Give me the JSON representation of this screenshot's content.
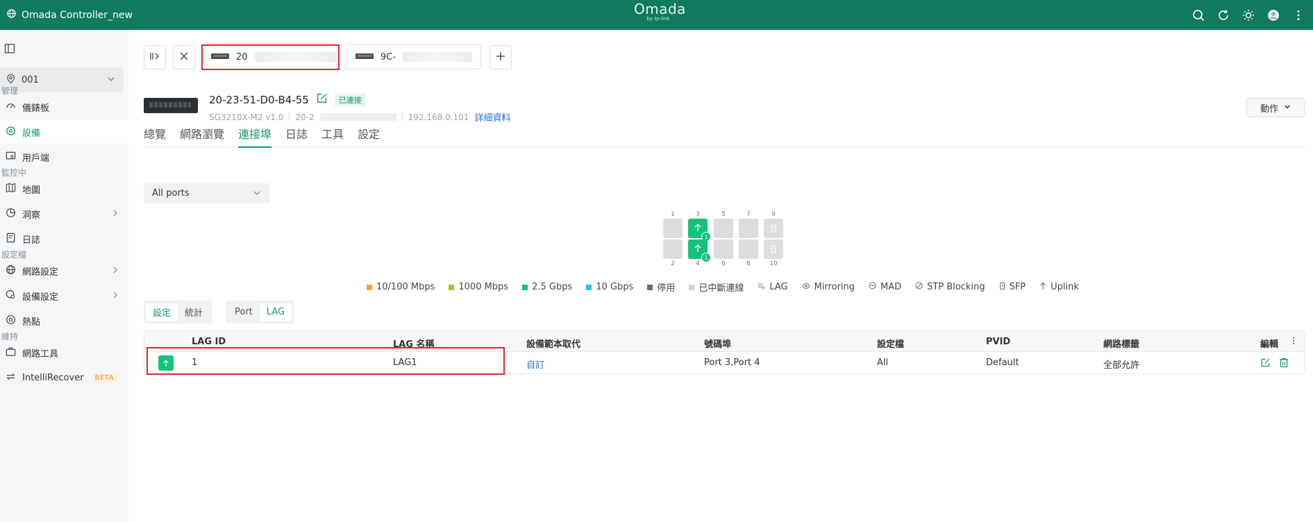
{
  "topbar": {
    "app_title": "Omada Controller_new",
    "logo_main": "Omada",
    "logo_sub": "by tp-link"
  },
  "sidebar": {
    "site": "001",
    "sections": [
      {
        "label": "管理"
      },
      {
        "label": "監控中"
      },
      {
        "label": "設定檔"
      },
      {
        "label": "維持"
      }
    ],
    "items": [
      {
        "label": "儀錶板"
      },
      {
        "label": "設備"
      },
      {
        "label": "用戶端"
      },
      {
        "label": "地圖"
      },
      {
        "label": "洞察"
      },
      {
        "label": "日誌"
      },
      {
        "label": "網路設定"
      },
      {
        "label": "設備設定"
      },
      {
        "label": "熱點"
      },
      {
        "label": "網路工具"
      },
      {
        "label": "IntelliRecover",
        "badge": "BETA"
      }
    ]
  },
  "device_tabs": [
    {
      "label": "20"
    },
    {
      "label": "9C-"
    }
  ],
  "device": {
    "name": "20-23-51-D0-B4-55",
    "status": "已連接",
    "model": "SG3210X-M2 v1.0",
    "mac_prefix": "20-2",
    "ip": "192.168.0.101",
    "details_link": "詳細資料",
    "action_label": "動作"
  },
  "tabs": [
    "總覽",
    "網路瀏覽",
    "連接埠",
    "日誌",
    "工具",
    "設定"
  ],
  "port_filter": "All ports",
  "ports": {
    "top_labels": [
      "1",
      "3",
      "5",
      "7",
      "9"
    ],
    "bottom_labels": [
      "2",
      "4",
      "6",
      "8",
      "10"
    ],
    "lag_badge": "1"
  },
  "legend": [
    {
      "label": "10/100 Mbps",
      "color": "#f5a623"
    },
    {
      "label": "1000 Mbps",
      "color": "#9ccc1c"
    },
    {
      "label": "2.5 Gbps",
      "color": "#14c27a"
    },
    {
      "label": "10 Gbps",
      "color": "#1ec8d8"
    },
    {
      "label": "停用",
      "color": "#6b6b6b"
    },
    {
      "label": "已中斷連線",
      "color": "#cfd1d4"
    },
    {
      "label": "LAG",
      "icon": "lag-icon"
    },
    {
      "label": "Mirroring",
      "icon": "eye-icon"
    },
    {
      "label": "MAD",
      "icon": "mad-icon"
    },
    {
      "label": "STP Blocking",
      "icon": "stp-icon"
    },
    {
      "label": "SFP",
      "icon": "sfp-icon"
    },
    {
      "label": "Uplink",
      "icon": "uplink-icon"
    }
  ],
  "seg1": [
    "設定",
    "統計"
  ],
  "seg2": [
    "Port",
    "LAG"
  ],
  "table": {
    "headers": [
      "LAG ID",
      "LAG 名稱",
      "設備範本取代",
      "號碼埠",
      "設定檔",
      "PVID",
      "網路標籤",
      "編輯"
    ],
    "rows": [
      {
        "lag_id": "1",
        "lag_name": "LAG1",
        "template": "自訂",
        "ports": "Port 3,Port 4",
        "profile": "All",
        "pvid": "Default",
        "tag": "全部允許"
      }
    ]
  },
  "colors": {
    "brand": "#0f7a5e",
    "accent": "#0f9a6a",
    "port_up": "#14c27a",
    "link": "#1f6fd1",
    "highlight": "#d72b2b"
  }
}
